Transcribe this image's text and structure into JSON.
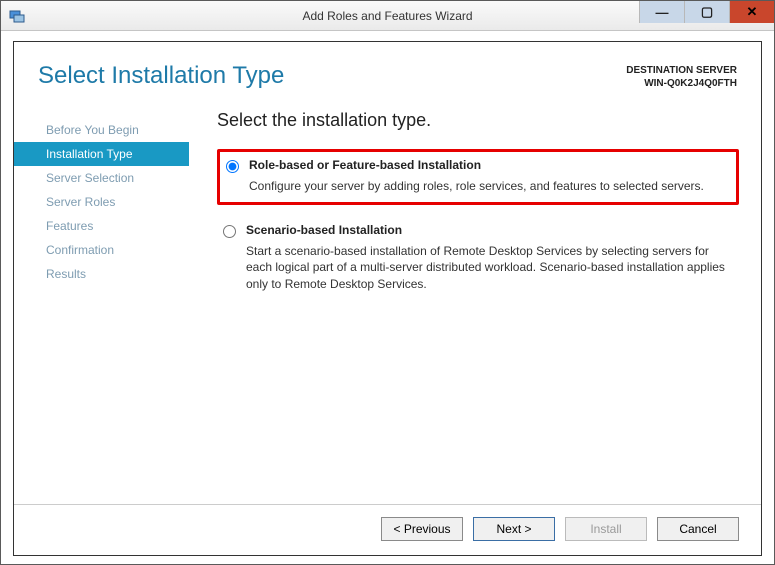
{
  "window": {
    "title": "Add Roles and Features Wizard"
  },
  "header": {
    "page_title": "Select Installation Type",
    "destination_label": "DESTINATION SERVER",
    "destination_value": "WIN-Q0K2J4Q0FTH"
  },
  "sidebar": {
    "items": [
      {
        "label": "Before You Begin",
        "active": false
      },
      {
        "label": "Installation Type",
        "active": true
      },
      {
        "label": "Server Selection",
        "active": false
      },
      {
        "label": "Server Roles",
        "active": false
      },
      {
        "label": "Features",
        "active": false
      },
      {
        "label": "Confirmation",
        "active": false
      },
      {
        "label": "Results",
        "active": false
      }
    ]
  },
  "main": {
    "heading": "Select the installation type.",
    "options": [
      {
        "label": "Role-based or Feature-based Installation",
        "description": "Configure your server by adding roles, role services, and features to selected servers.",
        "selected": true,
        "highlight": true
      },
      {
        "label": "Scenario-based Installation",
        "description": "Start a scenario-based installation of Remote Desktop Services by selecting servers for each logical part of a multi-server distributed workload. Scenario-based installation applies only to Remote Desktop Services.",
        "selected": false,
        "highlight": false
      }
    ]
  },
  "footer": {
    "previous": "< Previous",
    "next": "Next >",
    "install": "Install",
    "cancel": "Cancel"
  }
}
